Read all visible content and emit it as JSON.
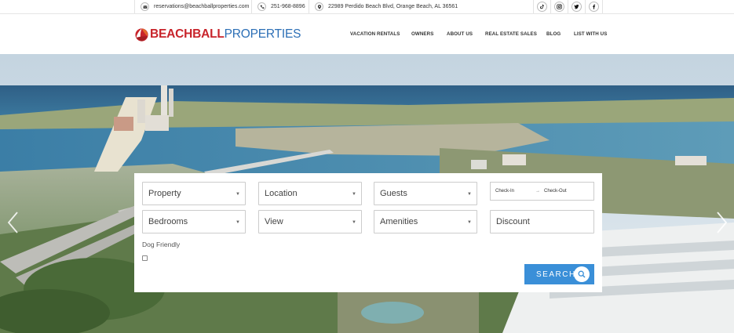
{
  "topbar": {
    "email": "reservations@beachballproperties.com",
    "phone": "251-968-8896",
    "address": "22989 Perdido Beach Blvd, Orange Beach, AL 36561",
    "icons": {
      "email": "envelope-icon",
      "phone": "phone-icon",
      "address": "map-pin-icon"
    },
    "social": [
      "tiktok-icon",
      "instagram-icon",
      "twitter-icon",
      "facebook-icon"
    ]
  },
  "logo": {
    "part1": "BEACHBALL",
    "part2": "PROPERTIES",
    "colors": {
      "red": "#c8242b",
      "blue": "#2c6fb6"
    }
  },
  "nav": {
    "vacation_rentals": "VACATION RENTALS",
    "owners": "OWNERS",
    "about_us": "ABOUT US",
    "real_estate_sales": "REAL ESTATE SALES",
    "blog": "BLOG",
    "list_with_us": "LIST WITH US"
  },
  "search": {
    "property": "Property",
    "location": "Location",
    "guests": "Guests",
    "check_in": "Check-In",
    "arrow": "→",
    "check_out": "Check-Out",
    "bedrooms": "Bedrooms",
    "view": "View",
    "amenities": "Amenities",
    "discount_placeholder": "Discount",
    "dog_friendly": "Dog Friendly",
    "search_label": "SEARCH",
    "caret": "▼",
    "accent": "#3a8fd8"
  },
  "carousel": {
    "prev_icon": "chevron-left-icon",
    "next_icon": "chevron-right-icon"
  }
}
